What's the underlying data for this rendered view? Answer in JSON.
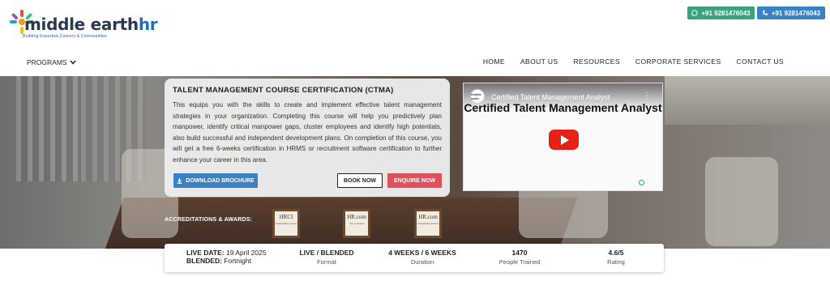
{
  "header": {
    "logo_text_main": "middle earth",
    "logo_text_hr": "hr",
    "logo_tagline": "Building Expertise,Careers & Communities",
    "phone_whatsapp": "+91 9281476043",
    "phone_call": "+91 9281476043"
  },
  "nav": {
    "programs": "PROGRAMS",
    "items": [
      "HOME",
      "ABOUT US",
      "RESOURCES",
      "CORPORATE SERVICES",
      "CONTACT US"
    ]
  },
  "course": {
    "title": "TALENT MANAGEMENT COURSE CERTIFICATION (CTMA)",
    "description": "This equips you with the skills to create and implement effective talent management strategies in your organization. Completing this course will help you predictively plan manpower, identify critical manpower gaps, cluster employees and identify high potentials, also build successful and independent development plans. On completion of this course, you will get a free 6-weeks certification in HRMS or recruitment software certification to further enhance your career in this area.",
    "download_label": "DOWNLOAD BROCHURE",
    "book_label": "BOOK NOW",
    "enquire_label": "ENQUIRE NOW"
  },
  "video": {
    "channel_avatar": "middle earth",
    "title": "Certified Talent Management Analyst",
    "heading": "Certified Talent Management Analyst"
  },
  "accreditations": {
    "label": "ACCREDITATIONS & AWARDS:",
    "badges": [
      {
        "name": "HRCI",
        "sub": "Outstanding Course"
      },
      {
        "name": "HR.com",
        "sub": "Top or Award"
      },
      {
        "name": "HR.com",
        "sub": "Outstanding Course"
      }
    ]
  },
  "stats": {
    "live_date_label": "LIVE DATE:",
    "live_date_value": "19 April 2025",
    "blended_label": "BLENDED:",
    "blended_value": "Fortnight",
    "items": [
      {
        "value": "LIVE / BLENDED",
        "label": "Format"
      },
      {
        "value": "4 WEEKS / 6 WEEKS",
        "label": "Duration"
      },
      {
        "value": "1470",
        "label": "People Trained"
      },
      {
        "value": "4.6/5",
        "label": "Rating"
      }
    ]
  },
  "colors": {
    "whatsapp_green": "#3aa37a",
    "brand_blue": "#3b82c4",
    "enquire_red": "#e0505a",
    "youtube_red": "#e62117"
  }
}
